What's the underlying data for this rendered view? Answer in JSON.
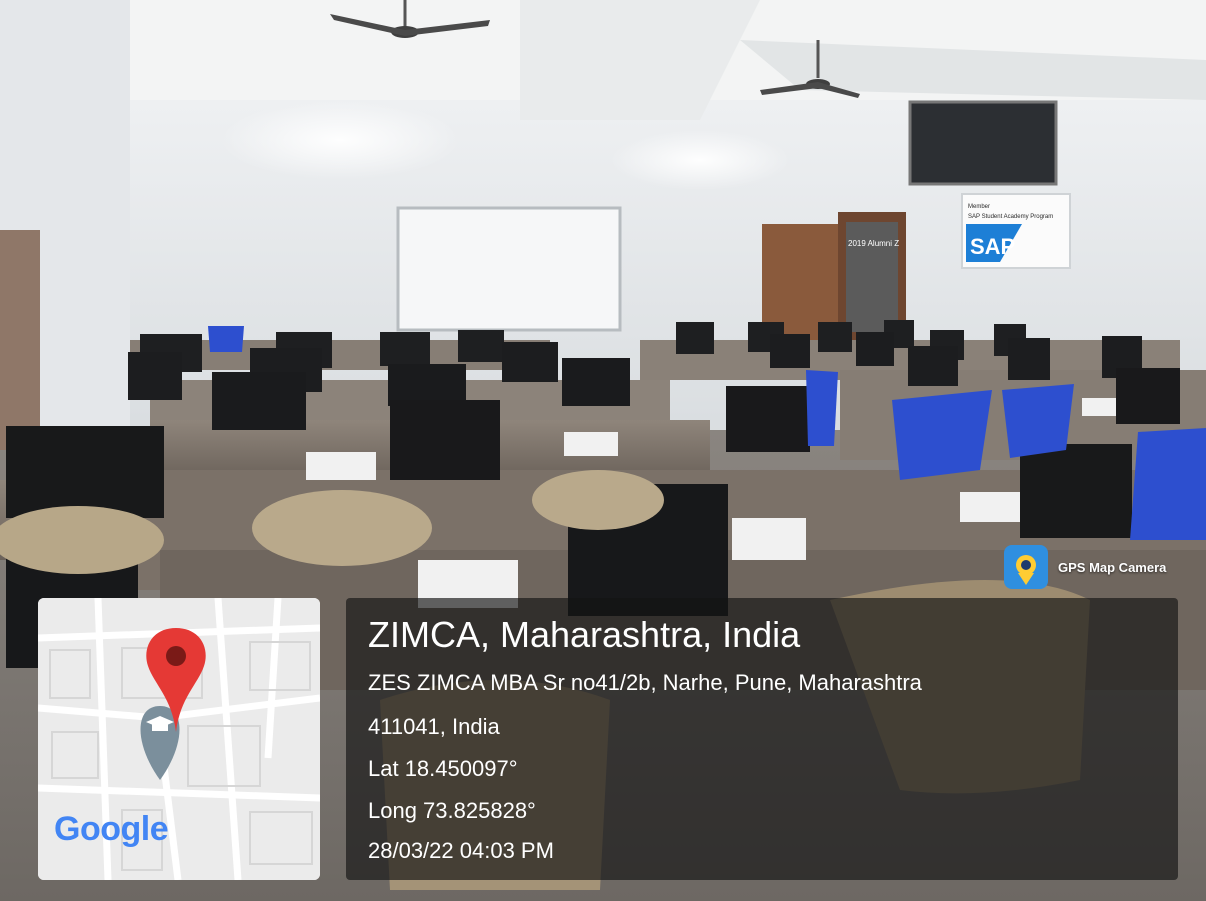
{
  "scene": {
    "sap_sign_member": "Member",
    "sap_sign_program": "SAP Student Academy Program",
    "sap_sign_logo": "SAP",
    "door_poster": "2019 Alumni Z"
  },
  "badge": {
    "label": "GPS Map Camera",
    "icon": "gps-map-camera-icon"
  },
  "map": {
    "google_logo": "Google",
    "pin_color": "#e53935",
    "place_icon": "graduation-cap-icon"
  },
  "info": {
    "title": "ZIMCA, Maharashtra, India",
    "address_line1": "ZES ZIMCA MBA Sr no41/2b, Narhe, Pune, Maharashtra",
    "address_line2": "411041, India",
    "latitude": "Lat 18.450097°",
    "longitude": "Long 73.825828°",
    "datetime": "28/03/22 04:03 PM"
  }
}
